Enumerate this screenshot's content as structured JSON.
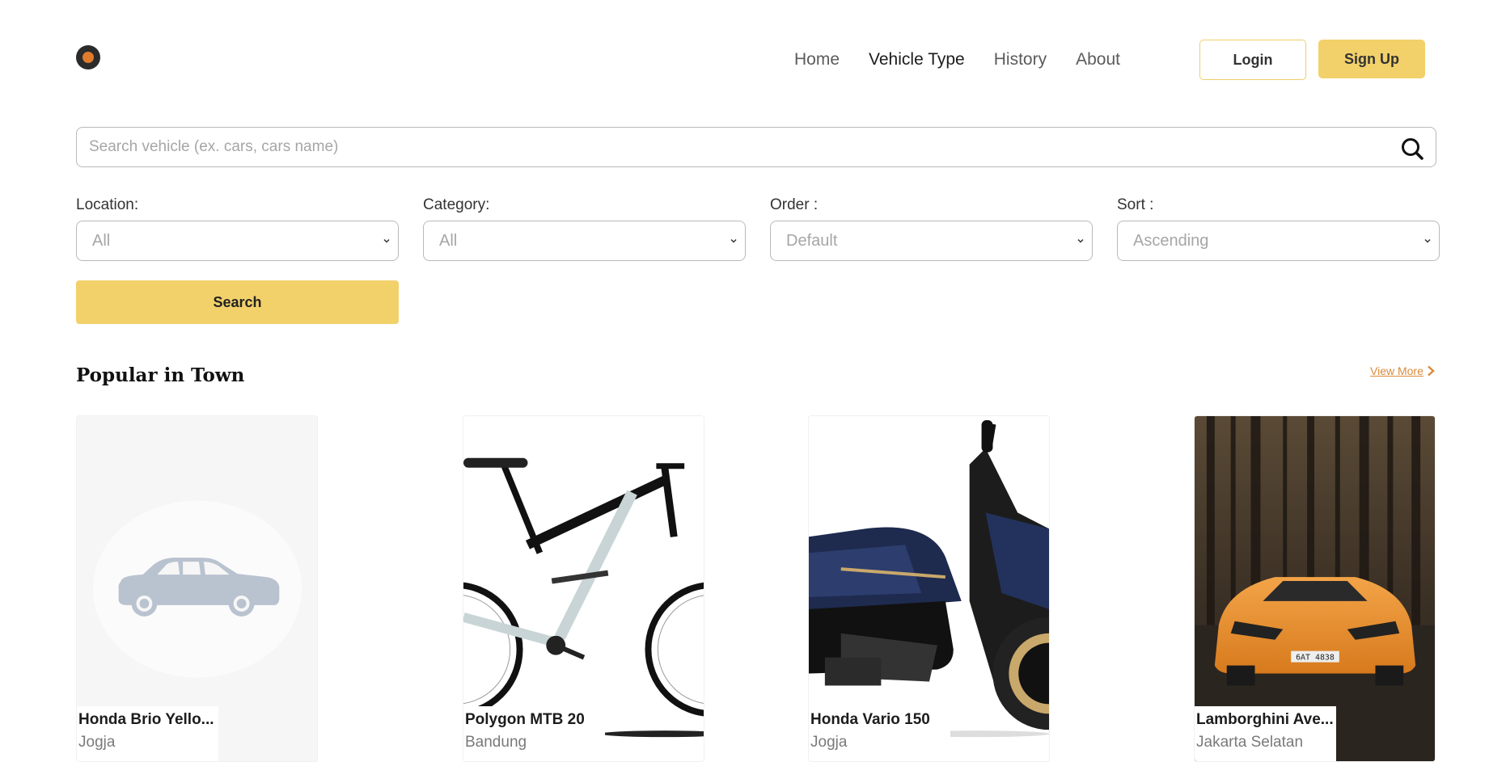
{
  "header": {
    "nav": [
      {
        "label": "Home",
        "active": false
      },
      {
        "label": "Vehicle Type",
        "active": true
      },
      {
        "label": "History",
        "active": false
      },
      {
        "label": "About",
        "active": false
      }
    ],
    "login_label": "Login",
    "signup_label": "Sign Up"
  },
  "search": {
    "placeholder": "Search vehicle (ex. cars, cars name)",
    "value": ""
  },
  "filters": {
    "location": {
      "label": "Location:",
      "selected": "All"
    },
    "category": {
      "label": "Category:",
      "selected": "All"
    },
    "order": {
      "label": "Order :",
      "selected": "Default"
    },
    "sort": {
      "label": "Sort :",
      "selected": "Ascending"
    },
    "search_label": "Search"
  },
  "popular": {
    "title": "Popular in Town",
    "view_more": "View More",
    "cards": [
      {
        "name": "Honda Brio Yello...",
        "location": "Jogja",
        "image": "car-placeholder-icon"
      },
      {
        "name": "Polygon MTB 20",
        "location": "Bandung",
        "image": "bicycle-photo"
      },
      {
        "name": "Honda Vario 150",
        "location": "Jogja",
        "image": "scooter-photo"
      },
      {
        "name": "Lamborghini Ave...",
        "location": "Jakarta Selatan",
        "image": "sports-car-photo"
      }
    ]
  },
  "colors": {
    "accent": "#f2d16b",
    "link": "#d98b3b",
    "logo": "#e07b2c"
  }
}
